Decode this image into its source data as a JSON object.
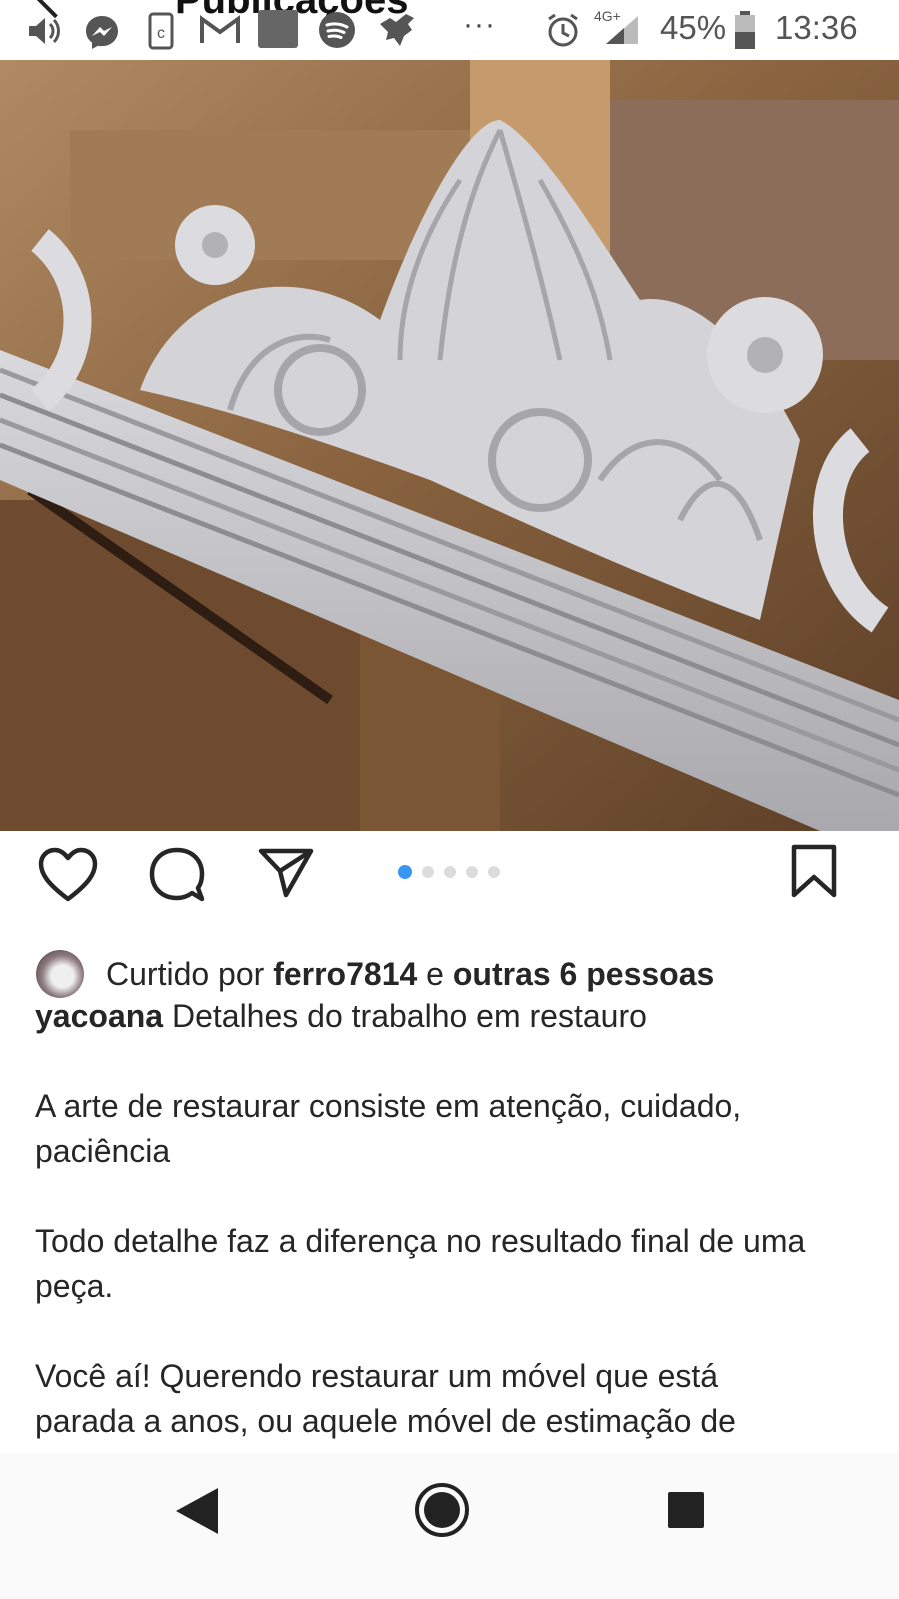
{
  "header": {
    "title": "Publicações"
  },
  "statusbar": {
    "network": "4G+",
    "battery": "45%",
    "time": "13:36",
    "overflow": "···",
    "icons": [
      "volume-icon",
      "messenger-icon",
      "app-icon",
      "gmail-icon",
      "app-square-icon",
      "spotify-icon",
      "bird-icon",
      "alarm-icon",
      "signal-icon",
      "battery-icon"
    ]
  },
  "post": {
    "image_alt": "Moldura de madeira entalhada com ornamentos pintados de cinza",
    "carousel": {
      "count": 5,
      "active": 1
    },
    "likes": {
      "prefix": "Curtido por",
      "user": "ferro7814",
      "connector": "e",
      "others": "outras 6 pessoas"
    },
    "caption": {
      "username": "yacoana",
      "first_line": "Detalhes do trabalho em restauro",
      "paragraph_1": "A arte de restaurar consiste em atenção, cuidado, paciência",
      "paragraph_2": "Todo detalhe faz a diferença no resultado final de uma peça.",
      "paragraph_3": "Você aí! Querendo restaurar um móvel que está parada a anos, ou aquele móvel de estimação de"
    }
  },
  "colors": {
    "accent": "#3897f0",
    "text": "#262626",
    "dot_inactive": "#dcdcdc"
  }
}
